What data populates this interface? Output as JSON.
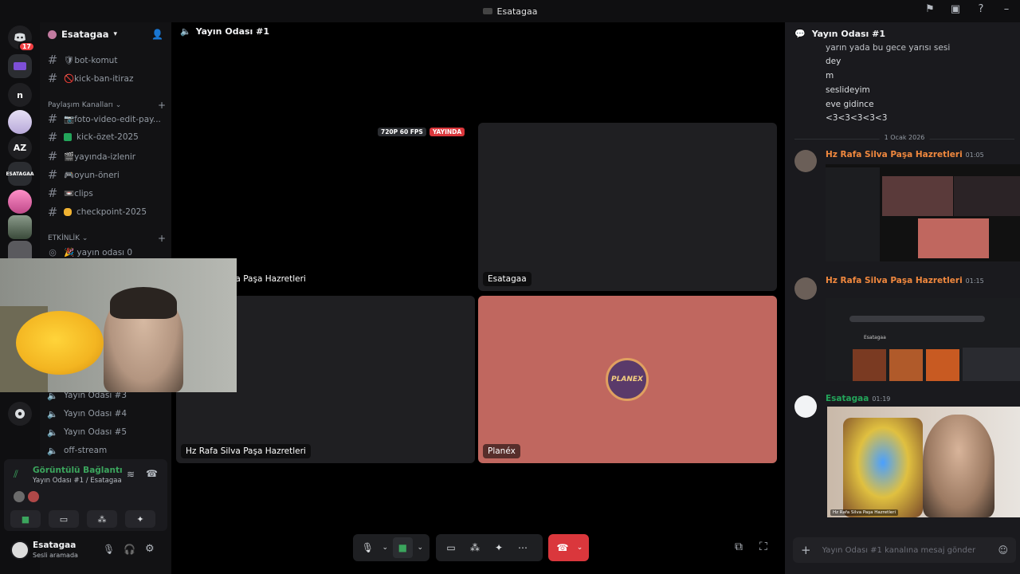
{
  "window": {
    "title": "Esatagaa"
  },
  "rail": {
    "dm_badge": "17",
    "servers": [
      "n",
      "AZ",
      "ESATAGAA"
    ]
  },
  "server": {
    "name": "Esatagaa"
  },
  "channels": {
    "top": [
      {
        "label": "🛡bot-komut"
      },
      {
        "label": "🚫kick-ban-itiraz"
      }
    ],
    "cat_share": "Paylaşım Kanalları",
    "share": [
      {
        "label": "📷foto-video-edit-pay..."
      },
      {
        "label": "kick-özet-2025",
        "color": "#23a55a"
      },
      {
        "label": "🎬yayında-izlenir"
      },
      {
        "label": "🎮oyun-öneri"
      },
      {
        "label": "📼clips"
      },
      {
        "label": "checkpoint-2025",
        "color": "#f0b232"
      }
    ],
    "cat_event": "ETKİNLİK",
    "event": [
      {
        "label": "🎉 yayın odası 0"
      }
    ],
    "voice": [
      {
        "label": "Yayın Odası #3"
      },
      {
        "label": "Yayın Odası #4"
      },
      {
        "label": "Yayın Odası #5"
      },
      {
        "label": "off-stream"
      }
    ]
  },
  "voice_panel": {
    "status": "Görüntülü Bağlantı Kuruldu",
    "sub": "Yayın Odası #1 / Esatagaa"
  },
  "user": {
    "name": "Esatagaa",
    "status": "Sesli aramada"
  },
  "stage": {
    "title": "Yayın Odası #1",
    "quality": "720P 60 FPS",
    "live": "YAYINDA",
    "tiles": [
      "Hz Rafa Silva Paşa Hazretleri",
      "Esatagaa",
      "Hz Rafa Silva Paşa Hazretleri",
      "Planéx"
    ],
    "avatar_text": "PLANEX"
  },
  "chat": {
    "title": "Yayın Odası #1",
    "early_lines": [
      "yarın yada bu gece yarısı sesi",
      "dey",
      "m",
      "seslideyim",
      "eve gidince",
      "<3<3<3<3<3"
    ],
    "date_divider": "1 Ocak 2026",
    "messages": [
      {
        "author": "Hz Rafa Silva Paşa Hazretleri",
        "time": "01:05",
        "color": "#f0883e"
      },
      {
        "author": "Hz Rafa Silva Paşa Hazretleri",
        "time": "01:15",
        "color": "#f0883e"
      },
      {
        "author": "Esatagaa",
        "time": "01:19",
        "color": "#23a55a"
      }
    ],
    "shot2_label": "Esatagaa",
    "shot3_caption": "Hz Rafa Silva Paşa Hazretleri",
    "input_placeholder": "Yayın Odası #1 kanalına mesaj gönder"
  }
}
